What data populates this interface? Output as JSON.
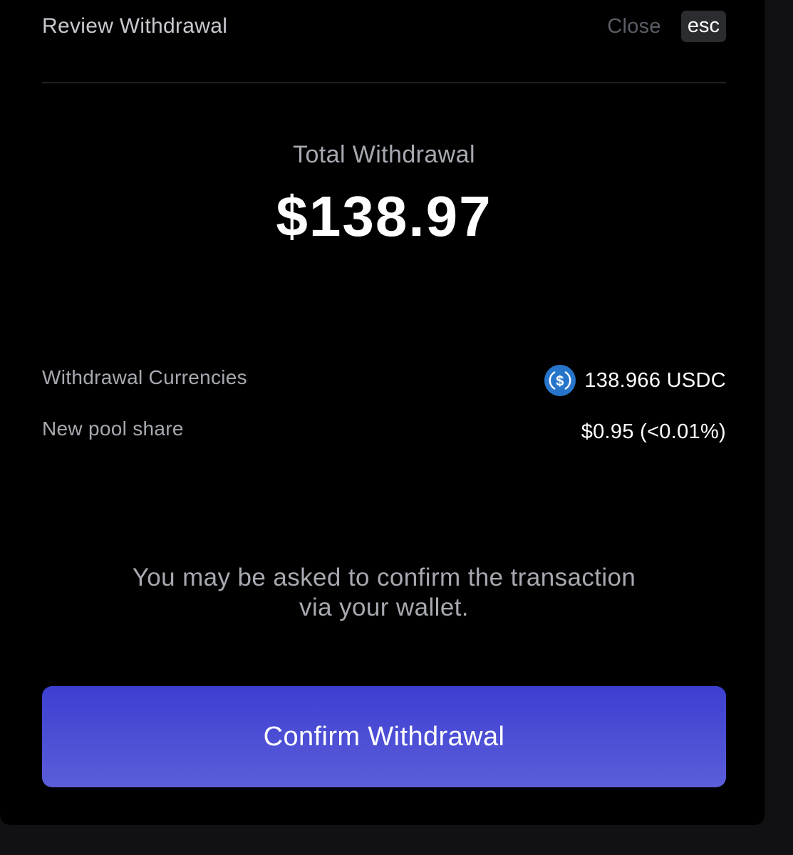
{
  "header": {
    "title": "Review Withdrawal",
    "close_label": "Close",
    "esc_label": "esc"
  },
  "summary": {
    "total_label": "Total Withdrawal",
    "total_amount": "$138.97"
  },
  "details": {
    "currencies_label": "Withdrawal Currencies",
    "currencies_value": "138.966 USDC",
    "currencies_icon": "usdc-icon",
    "pool_share_label": "New pool share",
    "pool_share_value": "$0.95 (<0.01%)"
  },
  "notice": {
    "line1": "You may be asked to confirm the transaction",
    "line2": "via your wallet."
  },
  "actions": {
    "confirm_label": "Confirm Withdrawal"
  },
  "colors": {
    "accent_top": "#3d3fd1",
    "accent_bottom": "#5b5ed9",
    "usdc_blue": "#2775ca",
    "background": "#000000"
  }
}
